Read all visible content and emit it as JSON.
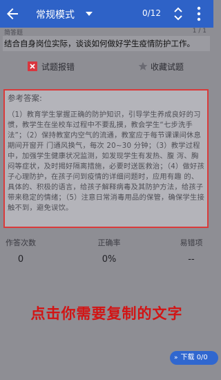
{
  "topbar": {
    "mode_label": "常规模式",
    "counter": "0/12",
    "icons": {
      "back": "back-arrow-icon",
      "dropdown": "chevron-down-icon",
      "nav": "up-down-icon",
      "more": "more-vert-icon"
    }
  },
  "question": {
    "tag": "简答题",
    "progress": "1 / 1",
    "text": "结合自身岗位实际，谈谈如何做好学生疫情防护工作。"
  },
  "actions": {
    "report_label": "试题报错",
    "favorite_label": "收藏试题"
  },
  "answer": {
    "title": "参考答案:",
    "body": "（1）教育学生掌握正确的防护知识，引导学生养成良好的习惯，教学生在坐校车过程中不要乱摸，教会学生“七步洗手法”；（2）保持教室内空气的流通，教室应于每节课课间休息期间开窗开 门通风换气，每次 20~30 分钟；（3）教学过程中，加强学生健康状况监测，如发现学生有发热、腹 泻、胸闷等症状，及时揭好隔离措施，必要时送医救治；（4）做好孩子心理防护，在孩子问到疫情的详细问题时，应用有趣 的、具体的、积极的语言，给孩子解释病毒及其防护方法，给孩子 带来稳定的情绪；（5）注意日常消毒用品的保管，确保学生接触不到，避免误饮。"
  },
  "stats": {
    "attempts_label": "作答次数",
    "attempts_value": "0",
    "accuracy_label": "正确率",
    "accuracy_value": "0%",
    "error_label": "易错项",
    "error_value": "--"
  },
  "overlay_hint": "点击你需要复制的文字",
  "download": {
    "label": "下载 0/0"
  },
  "colors": {
    "topbar": "#2e62c7",
    "highlight": "#d93a3a",
    "hint": "#d21414"
  }
}
